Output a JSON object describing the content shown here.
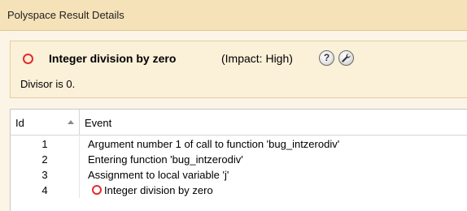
{
  "window": {
    "title": "Polyspace Result Details"
  },
  "result": {
    "check_name": "Integer division by zero",
    "impact": "(Impact: High)",
    "help_glyph": "?",
    "message": "Divisor is 0.",
    "status_color": "#e32c2c",
    "icons": [
      "circle-outline-icon",
      "help-icon",
      "wrench-icon"
    ]
  },
  "event_table": {
    "columns": {
      "id": "Id",
      "event": "Event"
    },
    "rows": [
      {
        "id": "1",
        "event": "Argument number 1 of call to function 'bug_intzerodiv'"
      },
      {
        "id": "2",
        "event": "Entering function 'bug_intzerodiv'"
      },
      {
        "id": "3",
        "event": "Assignment to local variable 'j'"
      },
      {
        "id": "4",
        "event": "Integer division by zero",
        "icon": "circle-outline-icon"
      }
    ]
  },
  "colors": {
    "title_bar": "#f6e2b9",
    "panel": "#fbf4e7",
    "summary_box": "#fbf0d8",
    "defect_red": "#e32c2c"
  }
}
